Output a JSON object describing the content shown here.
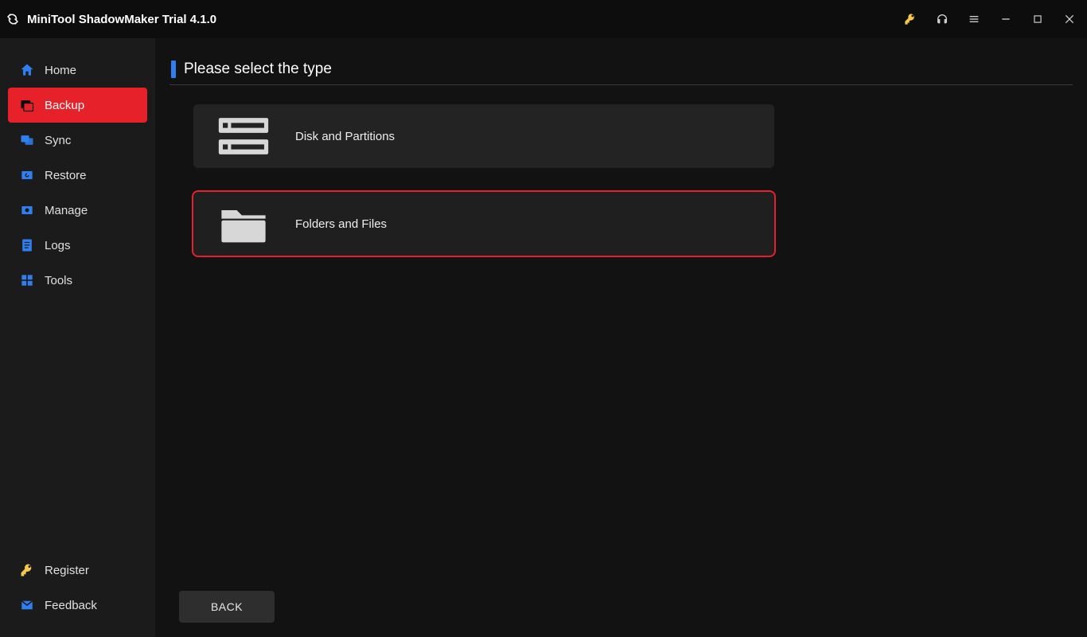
{
  "titlebar": {
    "app_title": "MiniTool ShadowMaker Trial 4.1.0"
  },
  "sidebar": {
    "items": [
      {
        "label": "Home"
      },
      {
        "label": "Backup"
      },
      {
        "label": "Sync"
      },
      {
        "label": "Restore"
      },
      {
        "label": "Manage"
      },
      {
        "label": "Logs"
      },
      {
        "label": "Tools"
      }
    ],
    "bottom": [
      {
        "label": "Register"
      },
      {
        "label": "Feedback"
      }
    ]
  },
  "main": {
    "heading": "Please select the type",
    "options": [
      {
        "label": "Disk and Partitions"
      },
      {
        "label": "Folders and Files"
      }
    ],
    "back_label": "BACK"
  }
}
